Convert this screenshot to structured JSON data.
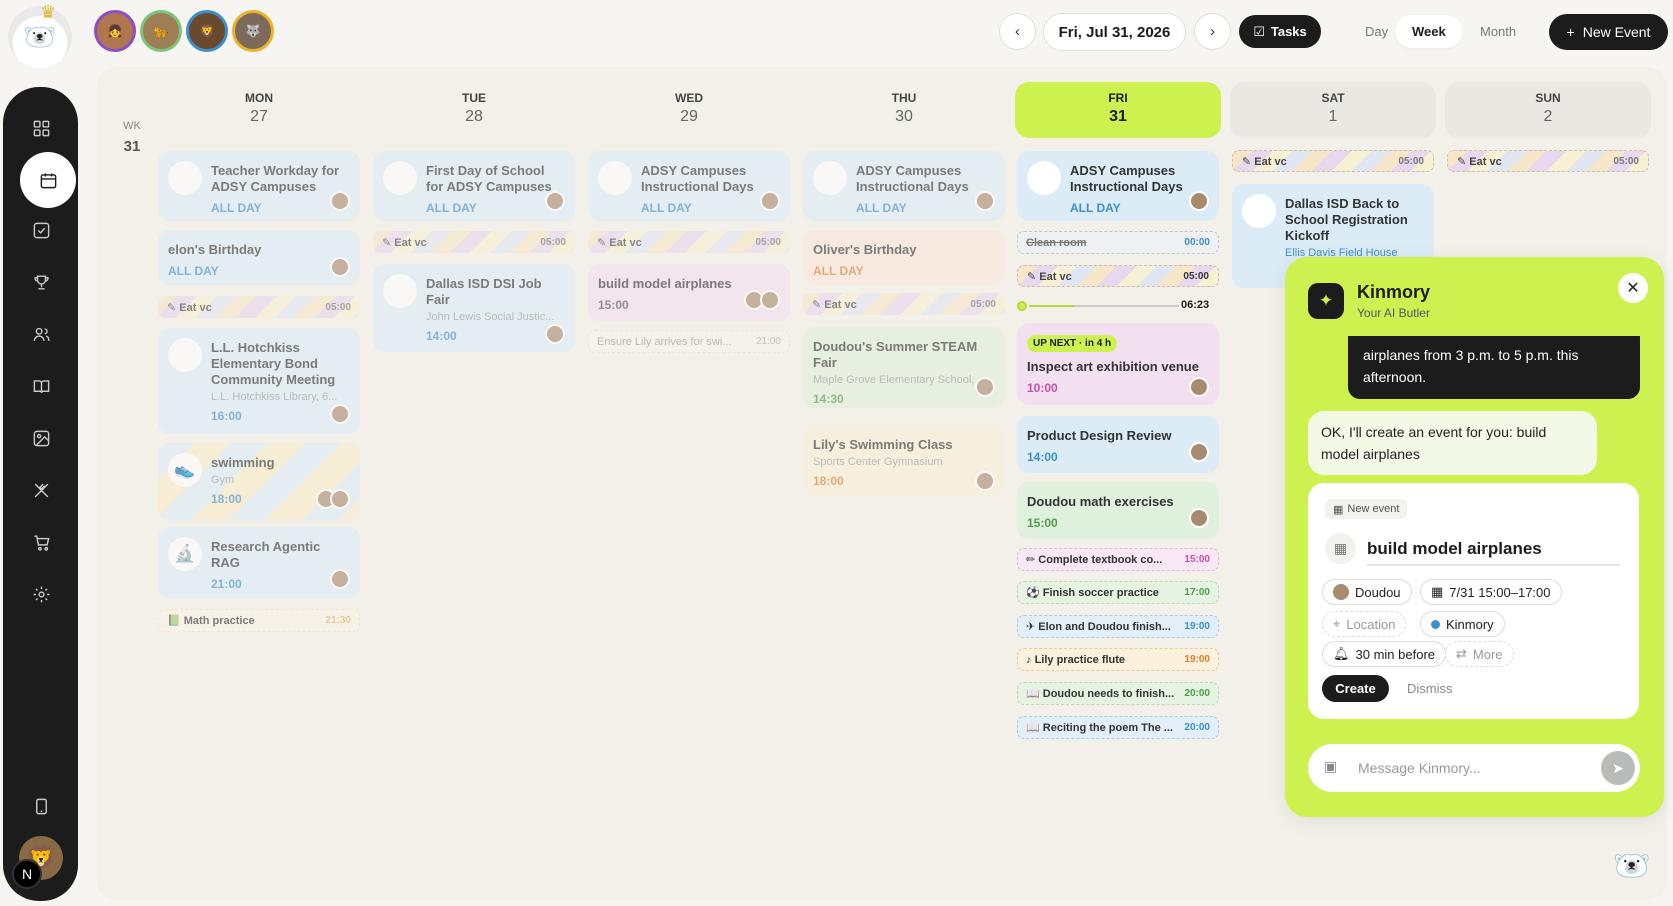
{
  "header": {
    "date": "Fri, Jul 31, 2026",
    "tasks_label": "Tasks",
    "views": [
      "Day",
      "Week",
      "Month"
    ],
    "active_view": "Week",
    "new_event_label": "New Event",
    "prev_icon": "chevron-left-icon",
    "next_icon": "chevron-right-icon"
  },
  "family_avatars": [
    {
      "name": "member-1",
      "ring": "#8a4fc7"
    },
    {
      "name": "member-2",
      "ring": "#7fc47a"
    },
    {
      "name": "member-3",
      "ring": "#3d8fc7"
    },
    {
      "name": "member-4",
      "ring": "#e8b52a"
    }
  ],
  "sidebar": {
    "items": [
      "dashboard",
      "calendar",
      "tasks",
      "rewards",
      "family",
      "book",
      "photos",
      "meals",
      "shopping",
      "settings"
    ],
    "active": "calendar",
    "bottom_badge": "N"
  },
  "week": {
    "label": "WK",
    "number": "31",
    "days": [
      {
        "name": "MON",
        "date": "27"
      },
      {
        "name": "TUE",
        "date": "28"
      },
      {
        "name": "WED",
        "date": "29"
      },
      {
        "name": "THU",
        "date": "30"
      },
      {
        "name": "FRI",
        "date": "31"
      },
      {
        "name": "SAT",
        "date": "1"
      },
      {
        "name": "SUN",
        "date": "2"
      }
    ]
  },
  "events": {
    "mon": {
      "teacher": {
        "title": "Teacher Workday for ADSY Campuses",
        "time": "ALL DAY"
      },
      "elon": {
        "title": "elon's Birthday",
        "time": "ALL DAY"
      },
      "eat": {
        "title": "Eat vc",
        "time": "05:00"
      },
      "hotchkiss": {
        "title": "L.L. Hotchkiss Elementary Bond Community Meeting",
        "location": "L.L. Hotchkiss Library, 6...",
        "time": "16:00"
      },
      "swim": {
        "title": "swimming",
        "location": "Gym",
        "time": "18:00"
      },
      "rag": {
        "title": "Research Agentic RAG",
        "time": "21:00"
      },
      "math": {
        "title": "Math practice",
        "time": "21:30"
      }
    },
    "tue": {
      "first": {
        "title": "First Day of School for ADSY Campuses",
        "time": "ALL DAY"
      },
      "eat": {
        "title": "Eat vc",
        "time": "05:00"
      },
      "jobfair": {
        "title": "Dallas ISD DSI Job Fair",
        "location": "John Lewis Social Justic...",
        "time": "14:00"
      }
    },
    "wed": {
      "adsy": {
        "title": "ADSY Campuses Instructional Days",
        "time": "ALL DAY"
      },
      "eat": {
        "title": "Eat vc",
        "time": "05:00"
      },
      "airplanes": {
        "title": "build model airplanes",
        "time": "15:00"
      },
      "lily": {
        "title": "Ensure Lily arrives for swi...",
        "time": "21:00"
      }
    },
    "thu": {
      "adsy": {
        "title": "ADSY Campuses Instructional Days",
        "time": "ALL DAY"
      },
      "oliver": {
        "title": "Oliver's Birthday",
        "time": "ALL DAY"
      },
      "eat": {
        "title": "Eat vc",
        "time": "05:00"
      },
      "steam": {
        "title": "Doudou's Summer STEAM Fair",
        "location": "Maple Grove Elementary School, ...",
        "time": "14:30"
      },
      "swimclass": {
        "title": "Lily's Swimming Class",
        "location": "Sports Center Gymnasium",
        "time": "18:00"
      }
    },
    "fri": {
      "adsy": {
        "title": "ADSY Campuses Instructional Days",
        "time": "ALL DAY"
      },
      "clean": {
        "title": "Clean room",
        "time": "00:00"
      },
      "eat": {
        "title": "Eat vc",
        "time": "05:00"
      },
      "now": "06:23",
      "up_next": "UP NEXT · in 4 h",
      "art": {
        "title": "Inspect art exhibition venue",
        "time": "10:00"
      },
      "design": {
        "title": "Product Design Review",
        "time": "14:00"
      },
      "mathx": {
        "title": "Doudou math exercises",
        "time": "15:00"
      },
      "tasks": [
        {
          "title": "Complete textbook co...",
          "time": "15:00",
          "icon": "pencil-icon",
          "color": "#c74fa8"
        },
        {
          "title": "Finish soccer practice",
          "time": "17:00",
          "icon": "soccer-icon",
          "color": "#4f9c4a"
        },
        {
          "title": "Elon and Doudou finish...",
          "time": "19:00",
          "icon": "plane-icon",
          "color": "#3d8fc7"
        },
        {
          "title": "Lily practice flute",
          "time": "19:00",
          "icon": "music-icon",
          "color": "#d9822b"
        },
        {
          "title": "Doudou needs to finish...",
          "time": "20:00",
          "icon": "book-icon",
          "color": "#4f9c4a"
        },
        {
          "title": "Reciting the poem The ...",
          "time": "20:00",
          "icon": "book-icon",
          "color": "#3d8fc7"
        }
      ]
    },
    "sat": {
      "eat": {
        "title": "Eat vc",
        "time": "05:00"
      },
      "kickoff": {
        "title": "Dallas ISD Back to School Registration Kickoff",
        "location": "Ellis Davis Field House"
      }
    },
    "sun": {
      "eat": {
        "title": "Eat vc",
        "time": "05:00"
      }
    }
  },
  "chat": {
    "title": "Kinmory",
    "subtitle": "Your AI Butler",
    "user_message": "airplanes from 3 p.m. to 5 p.m. this afternoon.",
    "bot_message": "OK, I'll create an event for you: build model airplanes",
    "card": {
      "tag": "New event",
      "title": "build model airplanes",
      "person": "Doudou",
      "datetime": "7/31 15:00–17:00",
      "location": "Location",
      "calendar": "Kinmory",
      "reminder": "30 min before",
      "more": "More",
      "create": "Create",
      "dismiss": "Dismiss"
    },
    "input_placeholder": "Message Kinmory...",
    "accent": "#cdf24f"
  }
}
